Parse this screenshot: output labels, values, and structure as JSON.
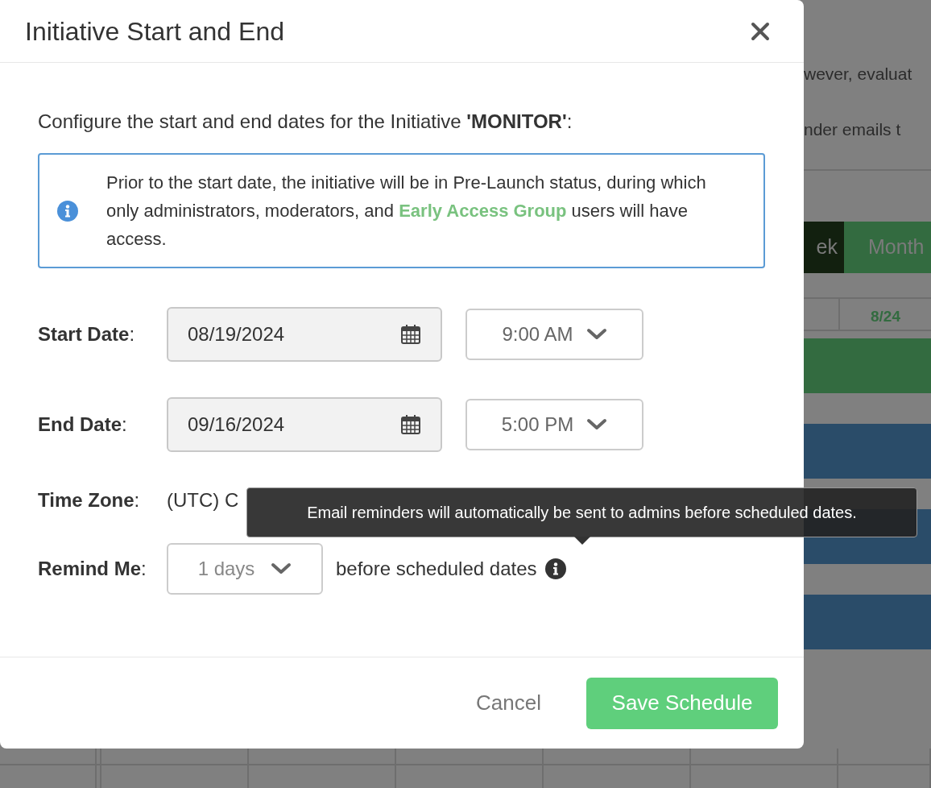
{
  "background": {
    "texts": [
      "wever, evaluat",
      "nder emails t"
    ],
    "view_tabs": [
      {
        "label": "ek",
        "selected": true
      },
      {
        "label": "Month",
        "selected": false
      }
    ],
    "column_header": "8/24",
    "bars": [
      {
        "color": "#336b40"
      },
      {
        "color": "#2a4c69"
      },
      {
        "color": "#2a4c69"
      },
      {
        "color": "#2a4c69"
      }
    ]
  },
  "dialog": {
    "title": "Initiative Start and End",
    "intro": "Configure the start and end dates for the Initiative **'MONITOR'**:",
    "notice": {
      "text": "Prior to the start date, the initiative will be in Pre-Launch status, during which only administrators, moderators, and",
      "link": "Early Access Group",
      "text_after": "users will have access."
    },
    "fields": [
      {
        "kind": "datetime",
        "label": "**Start Date**:",
        "date": "08/19/2024",
        "time": "9:00 AM"
      },
      {
        "kind": "datetime",
        "label": "**End Date**:",
        "date": "09/16/2024",
        "time": "5:00 PM"
      },
      {
        "kind": "text",
        "label": "**Time Zone**:",
        "value": "(UTC) C"
      },
      {
        "kind": "remind",
        "label": "**Remind Me**:",
        "value": "1 days",
        "suffix": "before scheduled dates"
      }
    ],
    "tooltip": "Email reminders will automatically be sent to admins before scheduled dates.",
    "buttons": [
      {
        "kind": "cancel",
        "label": "Cancel"
      },
      {
        "kind": "primary",
        "label": "Save Schedule"
      }
    ]
  }
}
